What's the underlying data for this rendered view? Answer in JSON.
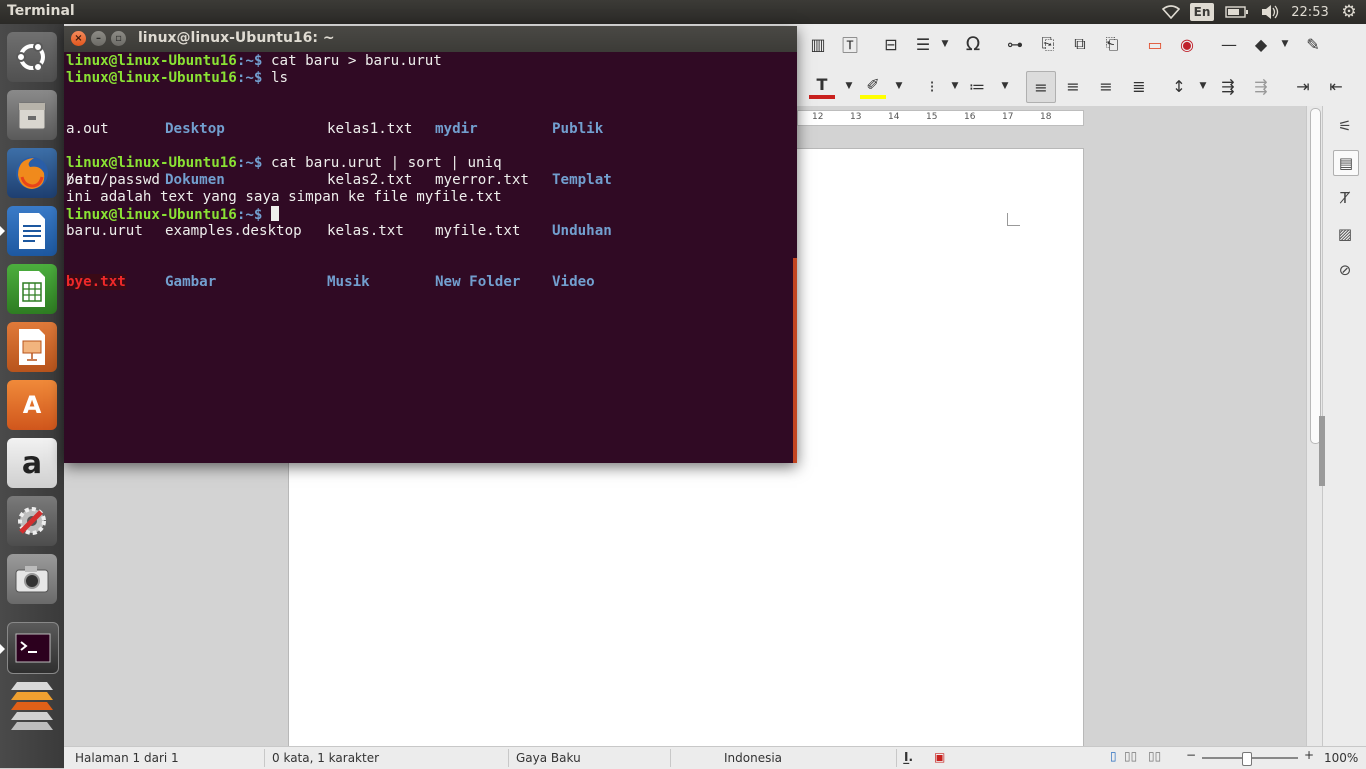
{
  "top_panel": {
    "app_title": "Terminal",
    "input_language": "En",
    "clock": "22:53"
  },
  "launcher": {
    "items": [
      {
        "name": "dash-home",
        "icon": "ubuntu-logo-icon"
      },
      {
        "name": "files",
        "icon": "file-cabinet-icon"
      },
      {
        "name": "firefox",
        "icon": "firefox-icon"
      },
      {
        "name": "libreoffice-writer",
        "icon": "writer-document-icon",
        "running": true
      },
      {
        "name": "libreoffice-calc",
        "icon": "calc-spreadsheet-icon"
      },
      {
        "name": "libreoffice-impress",
        "icon": "impress-presentation-icon"
      },
      {
        "name": "software-center",
        "icon": "shopping-bag-icon"
      },
      {
        "name": "amazon",
        "icon": "amazon-icon"
      },
      {
        "name": "system-settings",
        "icon": "settings-wrench-icon"
      },
      {
        "name": "camera",
        "icon": "camera-icon"
      },
      {
        "name": "terminal",
        "icon": "terminal-icon",
        "running": true
      },
      {
        "name": "workspaces",
        "icon": "workspace-stack-icon"
      }
    ]
  },
  "terminal": {
    "title": "linux@linux-Ubuntu16: ~",
    "prompt_user": "linux@linux-Ubuntu16",
    "prompt_path": ":~$",
    "commands": {
      "cmd1": " cat baru > baru.urut",
      "cmd2": " ls",
      "cmd3": " cat baru.urut | sort | uniq"
    },
    "ls_output": {
      "col1": [
        "a.out",
        "baru",
        "baru.urut",
        "bye.txt"
      ],
      "col2": [
        "Desktop",
        "Dokumen",
        "examples.desktop",
        "Gambar"
      ],
      "col3": [
        "kelas1.txt",
        "kelas2.txt",
        "kelas.txt",
        "Musik"
      ],
      "col4": [
        "mydir",
        "myerror.txt",
        "myfile.txt",
        "New Folder"
      ],
      "col5": [
        "Publik",
        "Templat",
        "Unduhan",
        "Video"
      ]
    },
    "output_lines": [
      "/etc/passwd",
      "ini adalah text yang saya simpan ke file myfile.txt"
    ]
  },
  "writer": {
    "ruler_numbers": [
      "12",
      "13",
      "14",
      "15",
      "16",
      "17",
      "18"
    ],
    "statusbar": {
      "page": "Halaman 1 dari 1",
      "words": "0 kata, 1 karakter",
      "style": "Gaya Baku",
      "language": "Indonesia",
      "zoom": "100%"
    },
    "colors": {
      "font_color": "#c9211e",
      "highlight_color": "#ffff00"
    }
  },
  "colors": {
    "terminal_bg": "#300a24",
    "prompt_user": "#8ae234",
    "prompt_path": "#729fcf",
    "directory": "#729fcf",
    "broken_link": "#ef2929"
  }
}
